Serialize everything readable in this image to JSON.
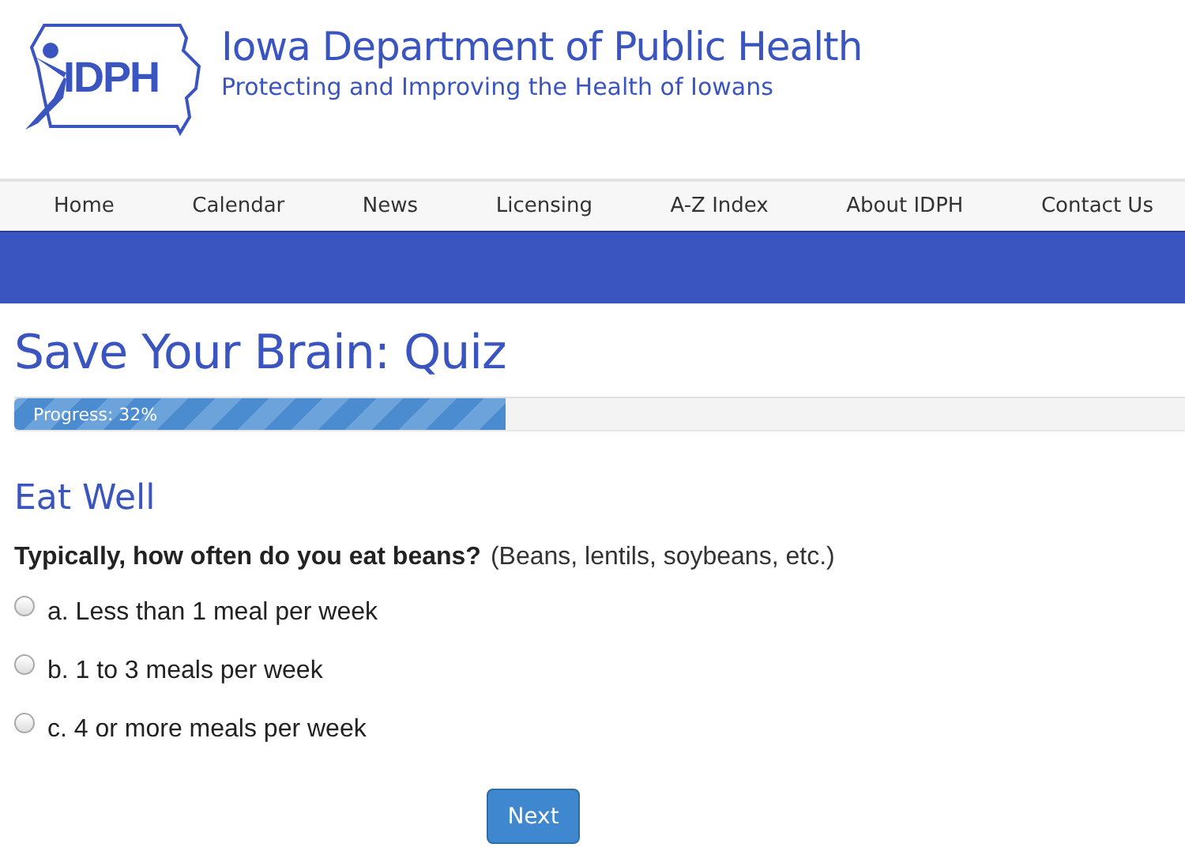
{
  "header": {
    "logo_text": "IDPH",
    "title": "Iowa Department of Public Health",
    "tagline": "Protecting and Improving the Health of Iowans"
  },
  "nav": [
    {
      "label": "Home"
    },
    {
      "label": "Calendar"
    },
    {
      "label": "News"
    },
    {
      "label": "Licensing"
    },
    {
      "label": "A-Z Index"
    },
    {
      "label": "About IDPH"
    },
    {
      "label": "Contact Us"
    }
  ],
  "page_title": "Save Your Brain: Quiz",
  "progress": {
    "label": "Progress: 32%",
    "level": 0.42
  },
  "section": "Eat Well",
  "question": {
    "text": "Typically, how often do you eat beans?",
    "hint": "(Beans, lentils, soybeans, etc.)"
  },
  "options": [
    {
      "label": "a. Less than 1 meal per week",
      "selected": false
    },
    {
      "label": "b. 1 to 3 meals per week",
      "selected": false
    },
    {
      "label": "c. 4 or more meals per week",
      "selected": false
    }
  ],
  "button": "Next"
}
